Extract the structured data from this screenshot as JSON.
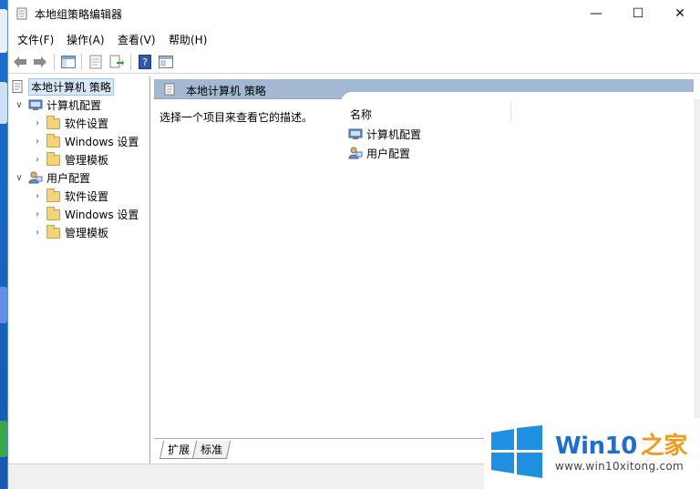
{
  "window": {
    "title": "本地组策略编辑器",
    "controls": [
      "—",
      "☐",
      "✕"
    ]
  },
  "menu": [
    "文件(F)",
    "操作(A)",
    "查看(V)",
    "帮助(H)"
  ],
  "toolbar": {
    "buttons": [
      "back-icon",
      "forward-icon",
      "show-hide-tree-icon",
      "properties-icon",
      "export-list-icon",
      "help-icon",
      "view-icon"
    ]
  },
  "tree": {
    "root": "本地计算机 策略",
    "computer_config": "计算机配置",
    "user_config": "用户配置",
    "children": [
      "软件设置",
      "Windows 设置",
      "管理模板"
    ]
  },
  "details": {
    "header": "本地计算机 策略",
    "description": "选择一个项目来查看它的描述。",
    "column_name": "名称",
    "items": [
      "计算机配置",
      "用户配置"
    ]
  },
  "tabs": [
    "扩展",
    "标准"
  ],
  "watermark": {
    "title_prefix": "Win10",
    "title_suffix": "之家",
    "url": "www.win10xitong.com"
  },
  "colors": {
    "header_band": "#a2b8d3",
    "selection": "#d9e8f7",
    "brand_blue": "#1f6fd0",
    "desktop": "#1a73c9"
  }
}
